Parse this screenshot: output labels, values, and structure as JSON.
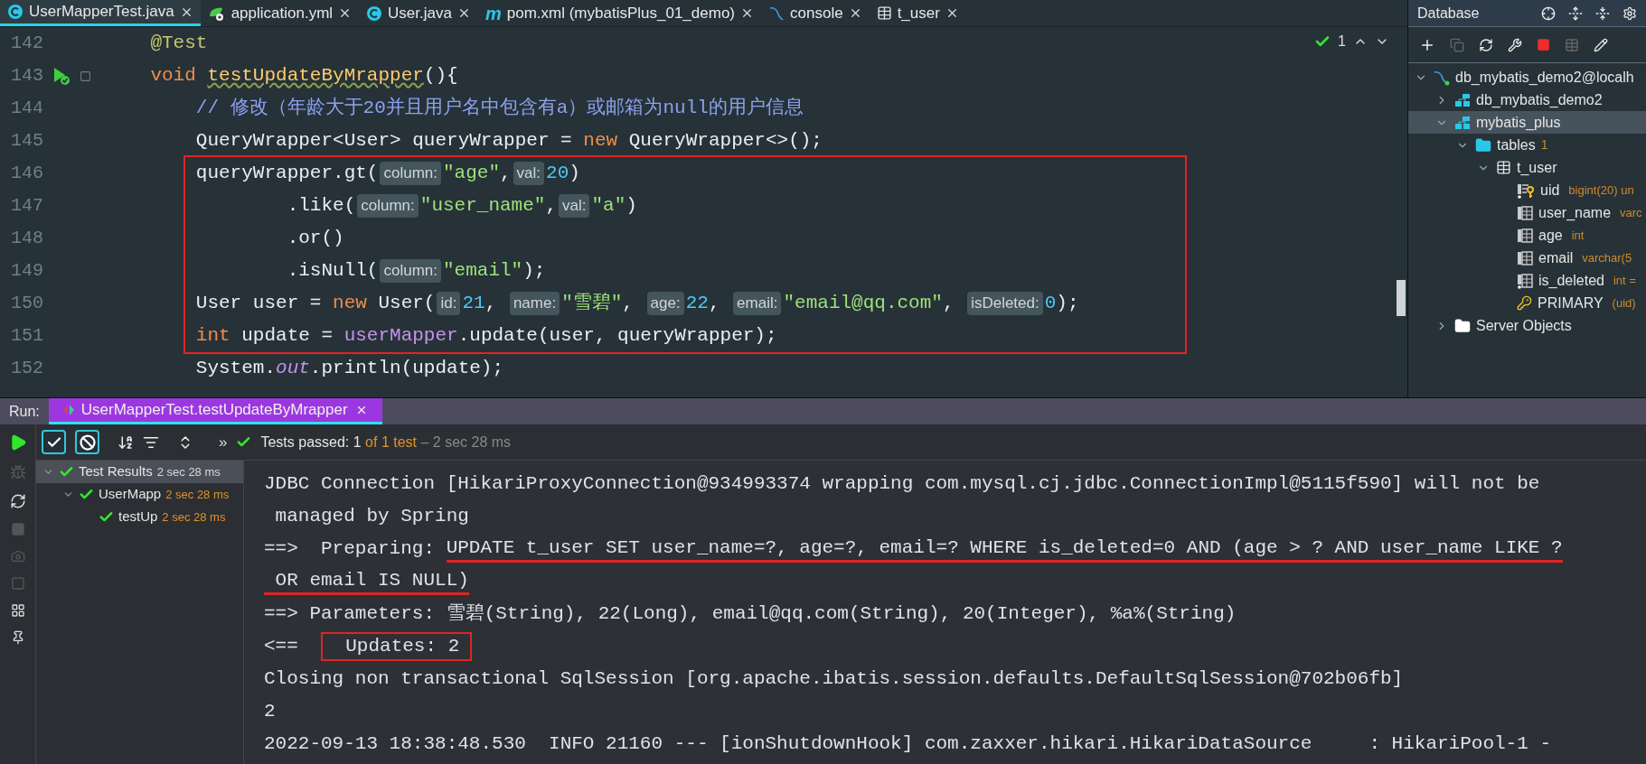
{
  "editor_tabs": [
    {
      "label": "UserMapperTest.java",
      "kind": "class",
      "selected": true
    },
    {
      "label": "application.yml",
      "kind": "yml",
      "selected": false
    },
    {
      "label": "User.java",
      "kind": "class",
      "selected": false
    },
    {
      "label": "pom.xml (mybatisPlus_01_demo)",
      "kind": "maven",
      "glyph": "m",
      "selected": false
    },
    {
      "label": "console",
      "kind": "console",
      "selected": false
    },
    {
      "label": "t_user",
      "kind": "table",
      "selected": false
    }
  ],
  "inspection": {
    "count": "1"
  },
  "code_lines": [
    {
      "number": "142",
      "framed": false,
      "tokens": [
        {
          "kind": "annotation",
          "t": "    @Test"
        }
      ]
    },
    {
      "number": "143",
      "run": true,
      "framed": false,
      "tokens": [
        {
          "kind": "keyword",
          "t": "    void "
        },
        {
          "kind": "method",
          "t": "testUpdateByMrapper"
        },
        {
          "kind": "plain",
          "t": "(){"
        }
      ]
    },
    {
      "number": "144",
      "framed": false,
      "tokens": [
        {
          "kind": "comment",
          "t": "        // 修改（年龄大于20并且用户名中包含有a）或邮箱为null的用户信息"
        }
      ]
    },
    {
      "number": "145",
      "framed": false,
      "tokens": [
        {
          "kind": "plain",
          "t": "        QueryWrapper<User> queryWrapper = "
        },
        {
          "kind": "keyword",
          "t": "new"
        },
        {
          "kind": "plain",
          "t": " QueryWrapper<>();"
        }
      ]
    },
    {
      "number": "146",
      "framed": true,
      "tokens": [
        {
          "kind": "plain",
          "t": "        queryWrapper.gt("
        },
        {
          "kind": "hint",
          "t": "column:"
        },
        {
          "kind": "string",
          "t": "\"age\""
        },
        {
          "kind": "plain",
          "t": ","
        },
        {
          "kind": "hint",
          "t": "val:"
        },
        {
          "kind": "number",
          "t": "20"
        },
        {
          "kind": "plain",
          "t": ")"
        }
      ]
    },
    {
      "number": "147",
      "framed": true,
      "tokens": [
        {
          "kind": "plain",
          "t": "                .like("
        },
        {
          "kind": "hint",
          "t": "column:"
        },
        {
          "kind": "string",
          "t": "\"user_name\""
        },
        {
          "kind": "plain",
          "t": ","
        },
        {
          "kind": "hint",
          "t": "val:"
        },
        {
          "kind": "string",
          "t": "\"a\""
        },
        {
          "kind": "plain",
          "t": ")"
        }
      ]
    },
    {
      "number": "148",
      "framed": true,
      "tokens": [
        {
          "kind": "plain",
          "t": "                .or()"
        }
      ]
    },
    {
      "number": "149",
      "framed": true,
      "tokens": [
        {
          "kind": "plain",
          "t": "                .isNull("
        },
        {
          "kind": "hint",
          "t": "column:"
        },
        {
          "kind": "string",
          "t": "\"email\""
        },
        {
          "kind": "plain",
          "t": ");"
        }
      ]
    },
    {
      "number": "150",
      "framed": true,
      "tokens": [
        {
          "kind": "plain",
          "t": "        User user = "
        },
        {
          "kind": "keyword",
          "t": "new"
        },
        {
          "kind": "plain",
          "t": " User("
        },
        {
          "kind": "hint",
          "t": "id:"
        },
        {
          "kind": "number",
          "t": "21"
        },
        {
          "kind": "plain",
          "t": ", "
        },
        {
          "kind": "hint",
          "t": "name:"
        },
        {
          "kind": "string",
          "t": "\"雪碧\""
        },
        {
          "kind": "plain",
          "t": ", "
        },
        {
          "kind": "hint",
          "t": "age:"
        },
        {
          "kind": "number",
          "t": "22"
        },
        {
          "kind": "plain",
          "t": ", "
        },
        {
          "kind": "hint",
          "t": "email:"
        },
        {
          "kind": "string",
          "t": "\"email@qq.com\""
        },
        {
          "kind": "plain",
          "t": ", "
        },
        {
          "kind": "hint",
          "t": "isDeleted:"
        },
        {
          "kind": "number",
          "t": "0"
        },
        {
          "kind": "plain",
          "t": ");"
        }
      ]
    },
    {
      "number": "151",
      "framed": true,
      "tokens": [
        {
          "kind": "keyword",
          "t": "        int"
        },
        {
          "kind": "plain",
          "t": " update = "
        },
        {
          "kind": "field",
          "t": "userMapper"
        },
        {
          "kind": "plain",
          "t": ".update(user, queryWrapper);"
        }
      ]
    },
    {
      "number": "152",
      "framed": false,
      "tokens": [
        {
          "kind": "plain",
          "t": "        System."
        },
        {
          "kind": "static",
          "t": "out"
        },
        {
          "kind": "plain",
          "t": ".println(update);"
        }
      ]
    }
  ],
  "database": {
    "title": "Database",
    "tree": [
      {
        "label": "db_mybatis_demo2@localh",
        "kind": "connection",
        "expanded": true,
        "selected": false,
        "children": [
          {
            "label": "db_mybatis_demo2",
            "kind": "schema",
            "expanded": false,
            "selected": false
          },
          {
            "label": "mybatis_plus",
            "kind": "schema",
            "expanded": true,
            "selected": true,
            "children": [
              {
                "label": "tables",
                "count": "1",
                "kind": "folder",
                "expanded": true,
                "selected": false,
                "children": [
                  {
                    "label": "t_user",
                    "kind": "table",
                    "expanded": true,
                    "selected": false,
                    "children": [
                      {
                        "label": "uid",
                        "type": "bigint(20) un",
                        "kind": "key-column",
                        "selected": false
                      },
                      {
                        "label": "user_name",
                        "type": "varc",
                        "kind": "column",
                        "selected": false
                      },
                      {
                        "label": "age",
                        "type": "int",
                        "kind": "column",
                        "selected": false
                      },
                      {
                        "label": "email",
                        "type": "varchar(5",
                        "kind": "column",
                        "selected": false
                      },
                      {
                        "label": "is_deleted",
                        "type": "int =",
                        "kind": "nn-column",
                        "selected": false
                      },
                      {
                        "label": "PRIMARY",
                        "type": "(uid)",
                        "kind": "key",
                        "selected": false
                      }
                    ]
                  }
                ]
              }
            ]
          },
          {
            "label": "Server Objects",
            "kind": "white-folder",
            "expanded": false,
            "selected": false
          }
        ]
      }
    ]
  },
  "run": {
    "label": "Run:",
    "tabs": [
      {
        "label": "UserMapperTest.testUpdateByMrapper",
        "selected": true
      }
    ],
    "toggles": [
      {
        "kind": "check",
        "on": true
      },
      {
        "kind": "ban",
        "on": true
      }
    ],
    "more": "»",
    "status": {
      "prefix": "Tests passed: ",
      "passed": "1",
      "of": " of 1 test",
      "time": " – 2 sec 28 ms"
    },
    "results": [
      {
        "label": "Test Results",
        "time": "2 sec 28 ms",
        "selected": true,
        "expanded": true,
        "children": [
          {
            "label": "UserMapp",
            "time": "2 sec 28 ms",
            "selected": false,
            "expanded": true,
            "children": [
              {
                "label": "testUp",
                "time": "2 sec 28 ms",
                "selected": false
              }
            ]
          }
        ]
      }
    ],
    "console": [
      [
        {
          "t": "JDBC Connection [HikariProxyConnection@934993374 wrapping com.mysql.cj.jdbc.ConnectionImpl@5115f590] will not be"
        }
      ],
      [
        {
          "t": " managed by Spring"
        }
      ],
      [
        {
          "t": "==>  Preparing: "
        },
        {
          "t": "UPDATE t_user SET user_name=?, age=?, email=? WHERE is_deleted=0 AND (age > ? AND user_name LIKE ?",
          "kind": "underline"
        }
      ],
      [
        {
          "t": " OR email IS NULL)",
          "kind": "underline"
        }
      ],
      [
        {
          "t": "==> Parameters: 雪碧(String), 22(Long), email@qq.com(String), 20(Integer), %a%(String)"
        }
      ],
      [
        {
          "t": "<==  "
        },
        {
          "t": "  Updates: 2",
          "kind": "box"
        }
      ],
      [
        {
          "t": "Closing non transactional SqlSession [org.apache.ibatis.session.defaults.DefaultSqlSession@702b06fb]"
        }
      ],
      [
        {
          "t": "2"
        }
      ],
      [
        {
          "t": "2022-09-13 18:38:48.530  INFO 21160 --- [ionShutdownHook] com.zaxxer.hikari.HikariDataSource     : HikariPool-1 -"
        }
      ]
    ]
  }
}
